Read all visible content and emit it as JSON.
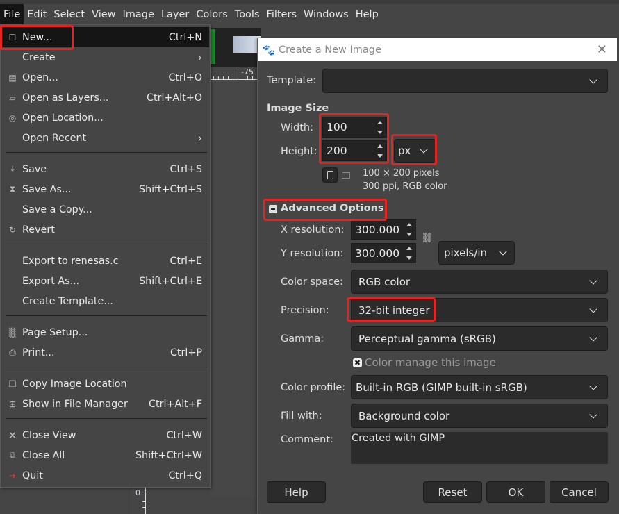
{
  "menubar": {
    "items": [
      "File",
      "Edit",
      "Select",
      "View",
      "Image",
      "Layer",
      "Colors",
      "Tools",
      "Filters",
      "Windows",
      "Help"
    ]
  },
  "canvas": {
    "ruler_label": "-75",
    "vruler_label": "0"
  },
  "file_menu": {
    "items": [
      {
        "label": "New...",
        "shortcut": "Ctrl+N",
        "icon": "new-image-icon"
      },
      {
        "label": "Create",
        "shortcut": "",
        "icon": "",
        "submenu": true
      },
      {
        "label": "Open...",
        "shortcut": "Ctrl+O",
        "icon": "open-icon"
      },
      {
        "label": "Open as Layers...",
        "shortcut": "Ctrl+Alt+O",
        "icon": "layers-icon"
      },
      {
        "label": "Open Location...",
        "shortcut": "",
        "icon": "globe-icon"
      },
      {
        "label": "Open Recent",
        "shortcut": "",
        "icon": "",
        "submenu": true
      },
      {
        "label": "Save",
        "shortcut": "Ctrl+S",
        "icon": "save-icon"
      },
      {
        "label": "Save As...",
        "shortcut": "Shift+Ctrl+S",
        "icon": "save-as-icon"
      },
      {
        "label": "Save a Copy...",
        "shortcut": "",
        "icon": ""
      },
      {
        "label": "Revert",
        "shortcut": "",
        "icon": "revert-icon"
      },
      {
        "label": "Export to renesas.c",
        "shortcut": "Ctrl+E",
        "icon": ""
      },
      {
        "label": "Export As...",
        "shortcut": "Shift+Ctrl+E",
        "icon": ""
      },
      {
        "label": "Create Template...",
        "shortcut": "",
        "icon": ""
      },
      {
        "label": "Page Setup...",
        "shortcut": "",
        "icon": "page-setup-icon"
      },
      {
        "label": "Print...",
        "shortcut": "Ctrl+P",
        "icon": "print-icon"
      },
      {
        "label": "Copy Image Location",
        "shortcut": "",
        "icon": "copy-icon"
      },
      {
        "label": "Show in File Manager",
        "shortcut": "Ctrl+Alt+F",
        "icon": "file-manager-icon"
      },
      {
        "label": "Close View",
        "shortcut": "Ctrl+W",
        "icon": "close-icon"
      },
      {
        "label": "Close All",
        "shortcut": "Shift+Ctrl+W",
        "icon": "close-all-icon"
      },
      {
        "label": "Quit",
        "shortcut": "Ctrl+Q",
        "icon": "quit-icon"
      }
    ]
  },
  "dialog": {
    "title": "Create a New Image",
    "template_label": "Template:",
    "template_value": "",
    "image_size_heading": "Image Size",
    "width_label": "Width:",
    "width_value": "100",
    "height_label": "Height:",
    "height_value": "200",
    "unit": "px",
    "info_line1": "100 × 200 pixels",
    "info_line2": "300 ppi, RGB color",
    "advanced_heading": "Advanced Options",
    "xres_label": "X resolution:",
    "xres_value": "300.000",
    "yres_label": "Y resolution:",
    "yres_value": "300.000",
    "res_unit": "pixels/in",
    "colorspace_label": "Color space:",
    "colorspace_value": "RGB color",
    "precision_label": "Precision:",
    "precision_value": "32-bit integer",
    "gamma_label": "Gamma:",
    "gamma_value": "Perceptual gamma (sRGB)",
    "color_manage_label": "Color manage this image",
    "color_manage_checked": true,
    "profile_label": "Color profile:",
    "profile_value": "Built-in RGB (GIMP built-in sRGB)",
    "fill_label": "Fill with:",
    "fill_value": "Background color",
    "comment_label": "Comment:",
    "comment_value": "Created with GIMP",
    "buttons": {
      "help": "Help",
      "reset": "Reset",
      "ok": "OK",
      "cancel": "Cancel"
    }
  },
  "colors": {
    "highlight_box": "#e8231f",
    "menu_highlight": "#151515"
  }
}
